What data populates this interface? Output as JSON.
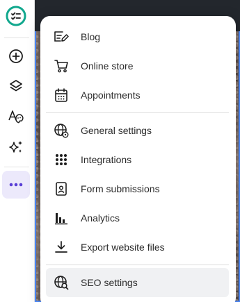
{
  "rail": {
    "items": [
      {
        "icon": "checklist-logo-icon",
        "color": "#12a88e"
      },
      {
        "icon": "add-circle-icon"
      },
      {
        "icon": "layers-icon"
      },
      {
        "icon": "font-palette-icon"
      },
      {
        "icon": "sparkles-icon"
      },
      {
        "icon": "more-horizontal-icon",
        "active": true,
        "accent": "#5a3fd6"
      }
    ]
  },
  "menu": {
    "sections": [
      {
        "items": [
          {
            "label": "Blog",
            "icon": "blog-edit-icon"
          },
          {
            "label": "Online store",
            "icon": "shopping-cart-icon"
          },
          {
            "label": "Appointments",
            "icon": "calendar-icon"
          }
        ]
      },
      {
        "items": [
          {
            "label": "General settings",
            "icon": "globe-gear-icon"
          },
          {
            "label": "Integrations",
            "icon": "grid-dots-icon"
          },
          {
            "label": "Form submissions",
            "icon": "form-document-icon"
          },
          {
            "label": "Analytics",
            "icon": "bar-chart-icon"
          },
          {
            "label": "Export website files",
            "icon": "download-icon"
          }
        ]
      },
      {
        "items": [
          {
            "label": "SEO settings",
            "icon": "seo-search-globe-icon",
            "hovered": true
          }
        ]
      }
    ]
  }
}
